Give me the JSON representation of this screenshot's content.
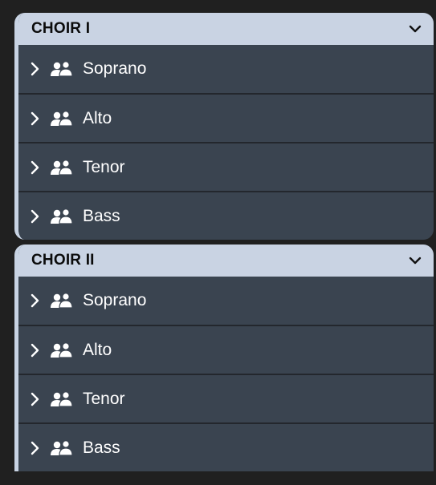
{
  "groups": [
    {
      "title": "CHOIR I",
      "collapse_icon": "chevron-down-icon",
      "rows": [
        {
          "label": "Soprano",
          "expand_icon": "chevron-right-icon",
          "icon": "people-icon"
        },
        {
          "label": "Alto",
          "expand_icon": "chevron-right-icon",
          "icon": "people-icon"
        },
        {
          "label": "Tenor",
          "expand_icon": "chevron-right-icon",
          "icon": "people-icon"
        },
        {
          "label": "Bass",
          "expand_icon": "chevron-right-icon",
          "icon": "people-icon"
        }
      ]
    },
    {
      "title": "CHOIR II",
      "collapse_icon": "chevron-down-icon",
      "rows": [
        {
          "label": "Soprano",
          "expand_icon": "chevron-right-icon",
          "icon": "people-icon"
        },
        {
          "label": "Alto",
          "expand_icon": "chevron-right-icon",
          "icon": "people-icon"
        },
        {
          "label": "Tenor",
          "expand_icon": "chevron-right-icon",
          "icon": "people-icon"
        },
        {
          "label": "Bass",
          "expand_icon": "chevron-right-icon",
          "icon": "people-icon"
        }
      ]
    }
  ],
  "colors": {
    "background": "#202020",
    "header": "#c9d3e3",
    "row": "#3a4450",
    "divider": "#23272d",
    "text": "#ffffff",
    "header_text": "#0b0b0b"
  }
}
